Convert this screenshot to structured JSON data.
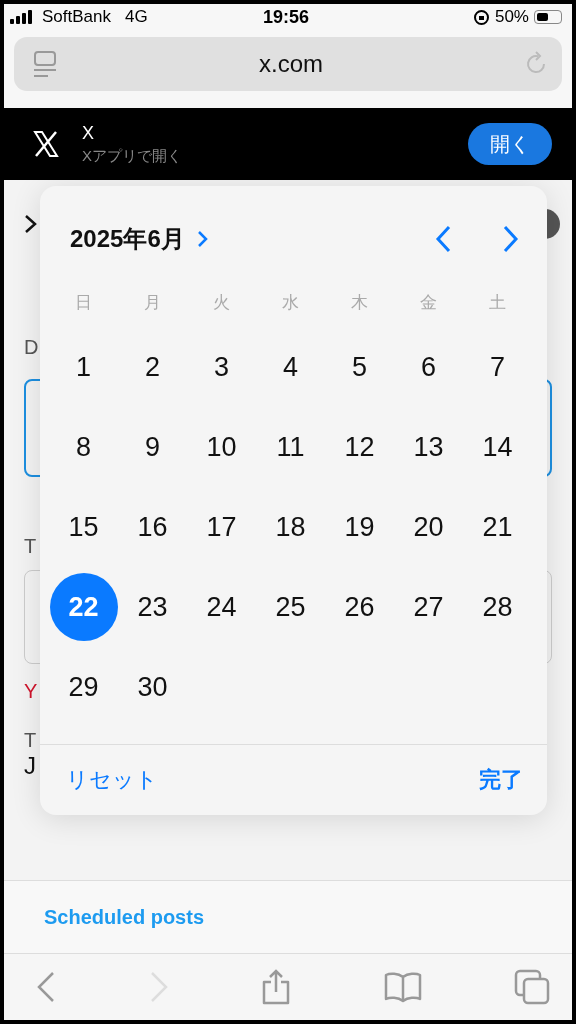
{
  "status_bar": {
    "carrier": "SoftBank",
    "network": "4G",
    "time": "19:56",
    "battery": "50%"
  },
  "browser": {
    "url": "x.com"
  },
  "app_banner": {
    "title": "X",
    "subtitle": "Xアプリで開く",
    "button": "開く"
  },
  "form": {
    "date_label": "D",
    "time_label": "T",
    "error": "Y",
    "timezone_label": "T",
    "timezone_value": "J"
  },
  "calendar": {
    "month": "2025年6月",
    "weekdays": [
      "日",
      "月",
      "火",
      "水",
      "木",
      "金",
      "土"
    ],
    "days": [
      {
        "label": "1",
        "selected": false
      },
      {
        "label": "2",
        "selected": false
      },
      {
        "label": "3",
        "selected": false
      },
      {
        "label": "4",
        "selected": false
      },
      {
        "label": "5",
        "selected": false
      },
      {
        "label": "6",
        "selected": false
      },
      {
        "label": "7",
        "selected": false
      },
      {
        "label": "8",
        "selected": false
      },
      {
        "label": "9",
        "selected": false
      },
      {
        "label": "10",
        "selected": false
      },
      {
        "label": "11",
        "selected": false
      },
      {
        "label": "12",
        "selected": false
      },
      {
        "label": "13",
        "selected": false
      },
      {
        "label": "14",
        "selected": false
      },
      {
        "label": "15",
        "selected": false
      },
      {
        "label": "16",
        "selected": false
      },
      {
        "label": "17",
        "selected": false
      },
      {
        "label": "18",
        "selected": false
      },
      {
        "label": "19",
        "selected": false
      },
      {
        "label": "20",
        "selected": false
      },
      {
        "label": "21",
        "selected": false
      },
      {
        "label": "22",
        "selected": true
      },
      {
        "label": "23",
        "selected": false
      },
      {
        "label": "24",
        "selected": false
      },
      {
        "label": "25",
        "selected": false
      },
      {
        "label": "26",
        "selected": false
      },
      {
        "label": "27",
        "selected": false
      },
      {
        "label": "28",
        "selected": false
      },
      {
        "label": "29",
        "selected": false
      },
      {
        "label": "30",
        "selected": false
      }
    ],
    "reset": "リセット",
    "done": "完了"
  },
  "scheduled_link": "Scheduled posts",
  "toolbar": {
    "back_disabled": false,
    "forward_disabled": true
  }
}
